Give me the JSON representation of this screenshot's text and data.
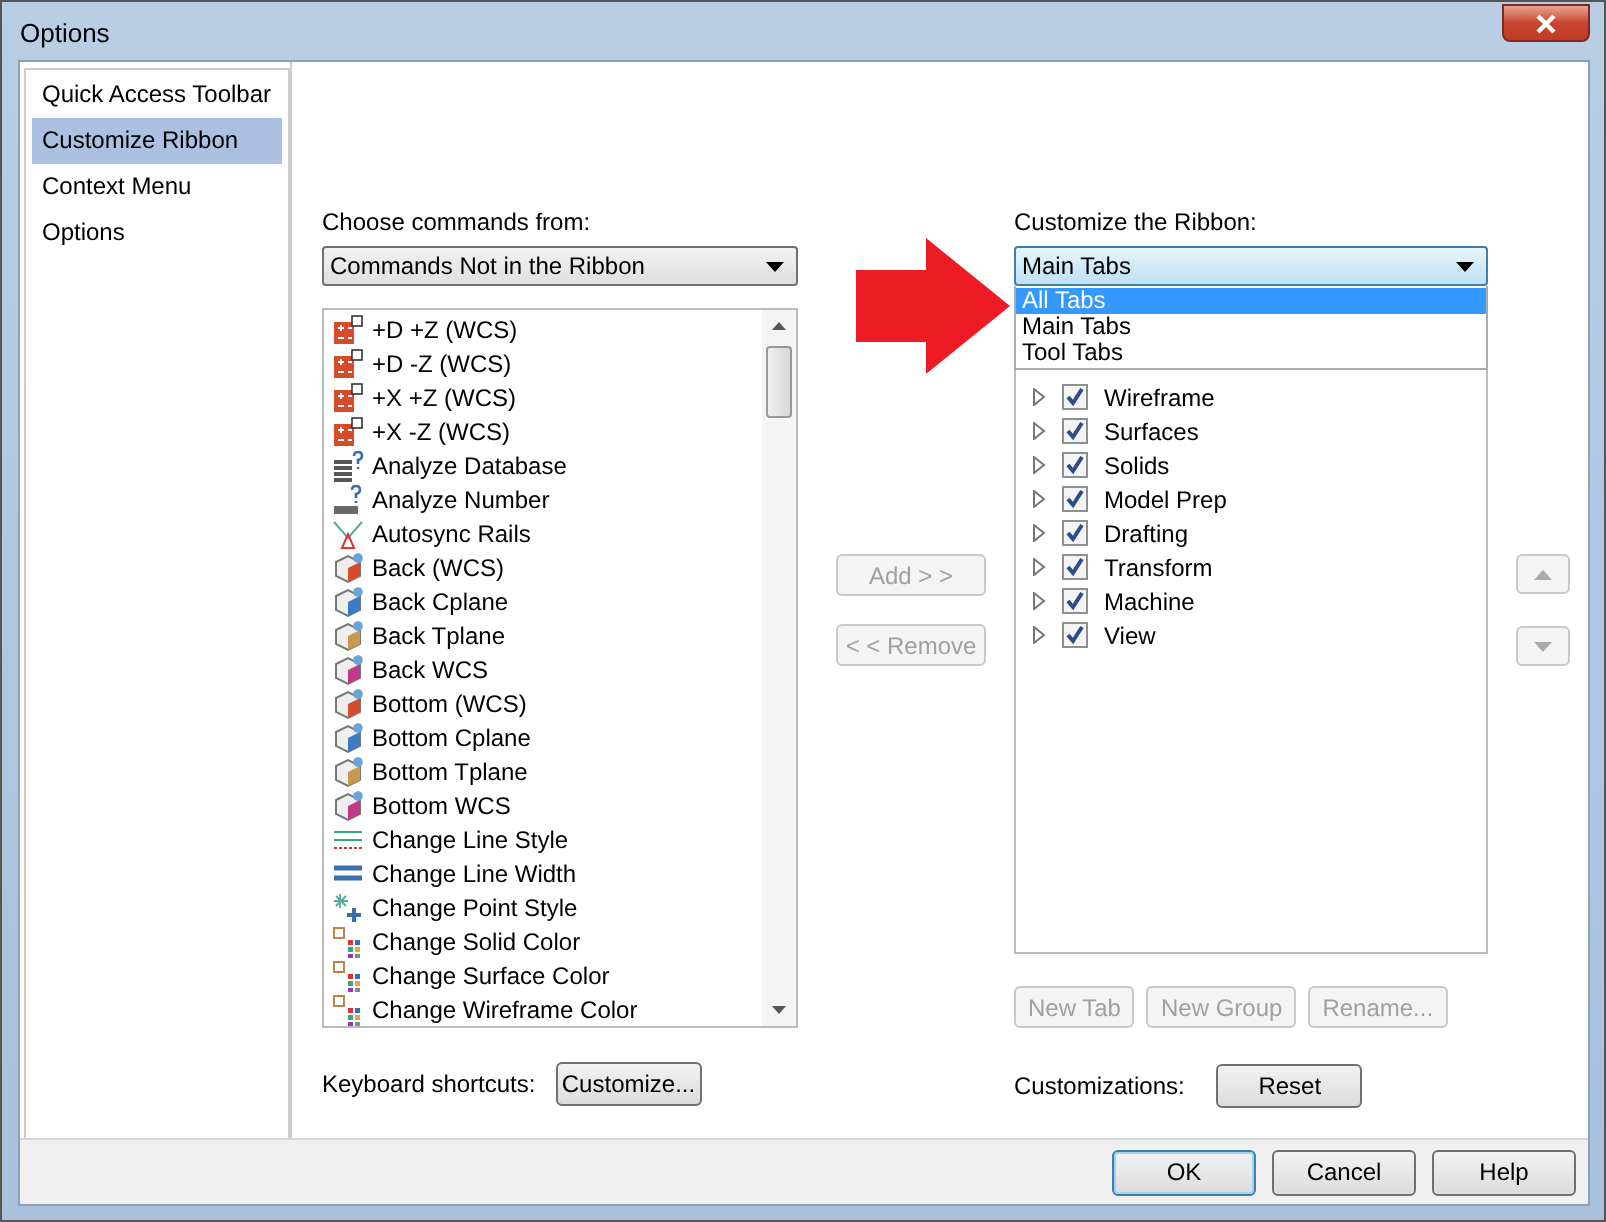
{
  "window": {
    "title": "Options"
  },
  "sidebar": {
    "items": [
      {
        "label": "Quick Access Toolbar",
        "selected": false
      },
      {
        "label": "Customize Ribbon",
        "selected": true
      },
      {
        "label": "Context Menu",
        "selected": false
      },
      {
        "label": "Options",
        "selected": false
      }
    ]
  },
  "commands": {
    "label": "Choose commands from:",
    "dropdown": "Commands Not in the Ribbon",
    "items": [
      "+D +Z (WCS)",
      "+D -Z (WCS)",
      "+X +Z (WCS)",
      "+X -Z (WCS)",
      "Analyze Database",
      "Analyze Number",
      "Autosync Rails",
      "Back (WCS)",
      "Back Cplane",
      "Back Tplane",
      "Back WCS",
      "Bottom (WCS)",
      "Bottom Cplane",
      "Bottom Tplane",
      "Bottom WCS",
      "Change Line Style",
      "Change Line Width",
      "Change Point Style",
      "Change Solid Color",
      "Change Surface Color",
      "Change Wireframe Color"
    ]
  },
  "middle_buttons": [
    {
      "label": "Add > >",
      "disabled": true
    },
    {
      "label": "< < Remove",
      "disabled": true
    }
  ],
  "ribbon": {
    "label": "Customize the Ribbon:",
    "dropdown": "Main Tabs",
    "dropdown_options": [
      {
        "label": "All Tabs",
        "selected": true
      },
      {
        "label": "Main Tabs",
        "selected": false
      },
      {
        "label": "Tool Tabs",
        "selected": false
      }
    ],
    "tree": [
      {
        "label": "Wireframe",
        "checked": true,
        "expanded": false
      },
      {
        "label": "Surfaces",
        "checked": true,
        "expanded": false
      },
      {
        "label": "Solids",
        "checked": true,
        "expanded": false
      },
      {
        "label": "Model Prep",
        "checked": true,
        "expanded": false
      },
      {
        "label": "Drafting",
        "checked": true,
        "expanded": false
      },
      {
        "label": "Transform",
        "checked": true,
        "expanded": false
      },
      {
        "label": "Machine",
        "checked": true,
        "expanded": false
      },
      {
        "label": "View",
        "checked": true,
        "expanded": false
      }
    ],
    "buttons": [
      {
        "label": "New Tab",
        "disabled": true
      },
      {
        "label": "New Group",
        "disabled": true
      },
      {
        "label": "Rename...",
        "disabled": true
      }
    ]
  },
  "keyboard": {
    "label": "Keyboard shortcuts:",
    "button": "Customize..."
  },
  "customizations": {
    "label": "Customizations:",
    "button": "Reset"
  },
  "footer_buttons": [
    "OK",
    "Cancel",
    "Help"
  ]
}
